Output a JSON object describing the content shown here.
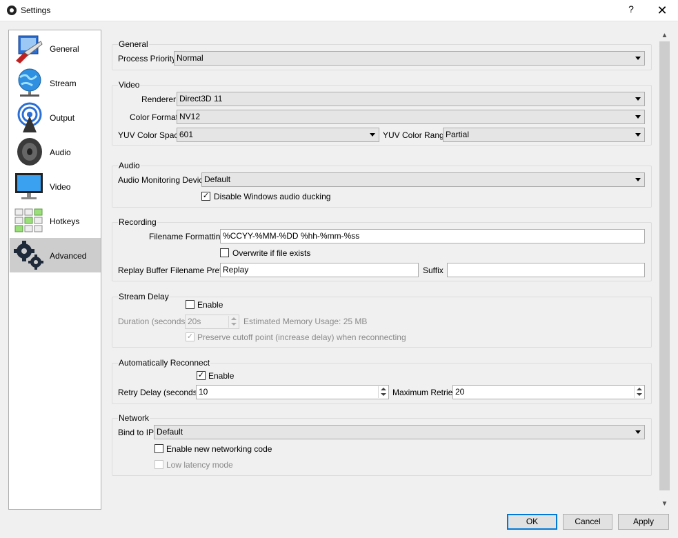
{
  "window": {
    "title": "Settings",
    "help": "?",
    "close": "✕"
  },
  "sidebar": {
    "items": [
      {
        "label": "General"
      },
      {
        "label": "Stream"
      },
      {
        "label": "Output"
      },
      {
        "label": "Audio"
      },
      {
        "label": "Video"
      },
      {
        "label": "Hotkeys"
      },
      {
        "label": "Advanced"
      }
    ]
  },
  "general": {
    "title": "General",
    "process_priority_label": "Process Priority",
    "process_priority_value": "Normal"
  },
  "video": {
    "title": "Video",
    "renderer_label": "Renderer",
    "renderer_value": "Direct3D 11",
    "color_format_label": "Color Format",
    "color_format_value": "NV12",
    "yuv_space_label": "YUV Color Space",
    "yuv_space_value": "601",
    "yuv_range_label": "YUV Color Range",
    "yuv_range_value": "Partial"
  },
  "audio": {
    "title": "Audio",
    "monitoring_label": "Audio Monitoring Device",
    "monitoring_value": "Default",
    "ducking_label": "Disable Windows audio ducking",
    "ducking_checked": "✓"
  },
  "recording": {
    "title": "Recording",
    "filename_label": "Filename Formatting",
    "filename_value": "%CCYY-%MM-%DD %hh-%mm-%ss",
    "overwrite_label": "Overwrite if file exists",
    "prefix_label": "Replay Buffer Filename Prefix",
    "prefix_value": "Replay",
    "suffix_label": "Suffix",
    "suffix_value": ""
  },
  "stream_delay": {
    "title": "Stream Delay",
    "enable_label": "Enable",
    "duration_label": "Duration (seconds)",
    "duration_value": "20s",
    "memory_label": "Estimated Memory Usage: 25 MB",
    "preserve_label": "Preserve cutoff point (increase delay) when reconnecting",
    "preserve_checked": "✓"
  },
  "reconnect": {
    "title": "Automatically Reconnect",
    "enable_label": "Enable",
    "enable_checked": "✓",
    "retry_delay_label": "Retry Delay (seconds)",
    "retry_delay_value": "10",
    "max_retries_label": "Maximum Retries",
    "max_retries_value": "20"
  },
  "network": {
    "title": "Network",
    "bind_label": "Bind to IP",
    "bind_value": "Default",
    "new_net_label": "Enable new networking code",
    "low_latency_label": "Low latency mode"
  },
  "buttons": {
    "ok": "OK",
    "cancel": "Cancel",
    "apply": "Apply"
  },
  "colors": {
    "accent": "#0078d7",
    "selected_sidebar": "#cdcdcd"
  }
}
